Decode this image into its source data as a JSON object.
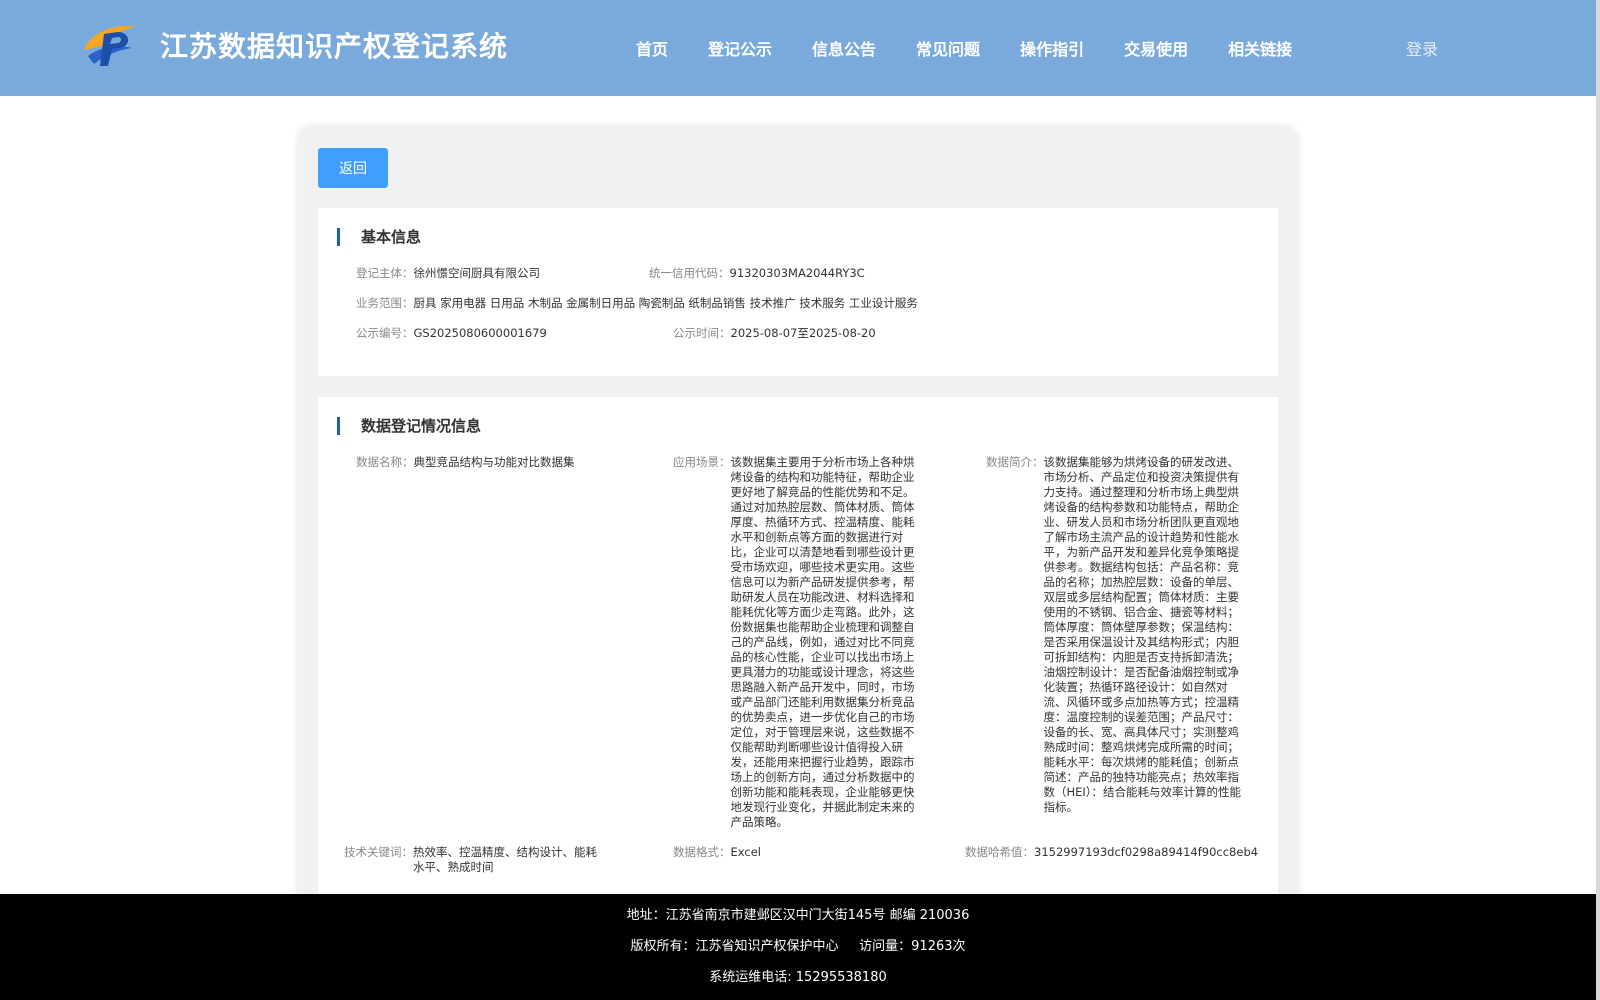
{
  "header": {
    "title": "江苏数据知识产权登记系统",
    "nav": [
      "首页",
      "登记公示",
      "信息公告",
      "常见问题",
      "操作指引",
      "交易使用",
      "相关链接"
    ],
    "login": "登录"
  },
  "back_label": "返回",
  "basic": {
    "heading": "基本信息",
    "entity": {
      "label": "登记主体：",
      "value": "徐州憬空间厨具有限公司"
    },
    "credit_code": {
      "label": "统一信用代码：",
      "value": "91320303MA2044RY3C"
    },
    "scope": {
      "label": "业务范围：",
      "value": "厨具 家用电器 日用品 木制品 金属制日用品 陶瓷制品 纸制品销售 技术推广 技术服务 工业设计服务"
    },
    "notice_no": {
      "label": "公示编号：",
      "value": "GS2025080600001679"
    },
    "notice_time": {
      "label": "公示时间：",
      "value": "2025-08-07至2025-08-20"
    }
  },
  "registration": {
    "heading": "数据登记情况信息",
    "data_name": {
      "label": "数据名称：",
      "value": "典型竞品结构与功能对比数据集"
    },
    "scenario": {
      "label": "应用场景：",
      "value": "该数据集主要用于分析市场上各种烘烤设备的结构和功能特征，帮助企业更好地了解竞品的性能优势和不足。通过对加热腔层数、筒体材质、筒体厚度、热循环方式、控温精度、能耗水平和创新点等方面的数据进行对比，企业可以清楚地看到哪些设计更受市场欢迎，哪些技术更实用。这些信息可以为新产品研发提供参考，帮助研发人员在功能改进、材料选择和能耗优化等方面少走弯路。此外，这份数据集也能帮助企业梳理和调整自己的产品线，例如，通过对比不同竞品的核心性能，企业可以找出市场上更具潜力的功能或设计理念，将这些思路融入新产品开发中，同时，市场或产品部门还能利用数据集分析竞品的优势卖点，进一步优化自己的市场定位，对于管理层来说，这些数据不仅能帮助判断哪些设计值得投入研发，还能用来把握行业趋势，跟踪市场上的创新方向，通过分析数据中的创新功能和能耗表现，企业能够更快地发现行业变化，并据此制定未来的产品策略。"
    },
    "summary": {
      "label": "数据简介：",
      "value": "该数据集能够为烘烤设备的研发改进、市场分析、产品定位和投资决策提供有力支持。通过整理和分析市场上典型烘烤设备的结构参数和功能特点，帮助企业、研发人员和市场分析团队更直观地了解市场主流产品的设计趋势和性能水平，为新产品开发和差异化竞争策略提供参考。数据结构包括：产品名称：竞品的名称；加热腔层数：设备的单层、双层或多层结构配置；筒体材质：主要使用的不锈钢、铝合金、搪瓷等材料；筒体厚度：筒体壁厚参数；保温结构：是否采用保温设计及其结构形式；内胆可拆卸结构：内胆是否支持拆卸清洗；油烟控制设计：是否配备油烟控制或净化装置；热循环路径设计：如自然对流、风循环或多点加热等方式；控温精度：温度控制的误差范围；产品尺寸：设备的长、宽、高具体尺寸；实测整鸡熟成时间：整鸡烘烤完成所需的时间；能耗水平：每次烘烤的能耗值；创新点简述：产品的独特功能亮点；热效率指数（HEI）：结合能耗与效率计算的性能指标。"
    },
    "keywords": {
      "label": "技术关键词：",
      "value": "热效率、控温精度、结构设计、能耗水平、熟成时间"
    },
    "format": {
      "label": "数据格式：",
      "value": "Excel"
    },
    "hash": {
      "label": "数据哈希值：",
      "value": "3152997193dcf0298a89414f90cc8eb4"
    }
  },
  "footer": {
    "address": "地址：江苏省南京市建邺区汉中门大街145号 邮编 210036",
    "copyright": "版权所有：江苏省知识产权保护中心",
    "visits": "访问量：91263次",
    "phone": "系统运维电话: 15295538180"
  },
  "colors": {
    "header": "#7aa9dc",
    "button": "#409eff",
    "accent": "#1f5fa8",
    "footer": "#000000"
  }
}
